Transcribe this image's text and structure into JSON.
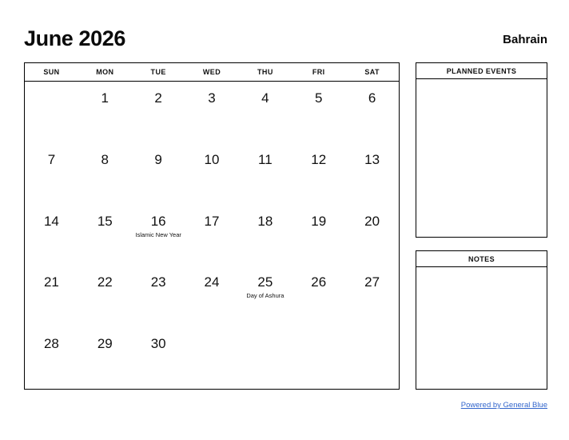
{
  "header": {
    "month_title": "June 2026",
    "country": "Bahrain"
  },
  "calendar": {
    "weekday_headers": [
      "SUN",
      "MON",
      "TUE",
      "WED",
      "THU",
      "FRI",
      "SAT"
    ],
    "weeks": [
      [
        {
          "day": "",
          "event": ""
        },
        {
          "day": "1",
          "event": ""
        },
        {
          "day": "2",
          "event": ""
        },
        {
          "day": "3",
          "event": ""
        },
        {
          "day": "4",
          "event": ""
        },
        {
          "day": "5",
          "event": ""
        },
        {
          "day": "6",
          "event": ""
        }
      ],
      [
        {
          "day": "7",
          "event": ""
        },
        {
          "day": "8",
          "event": ""
        },
        {
          "day": "9",
          "event": ""
        },
        {
          "day": "10",
          "event": ""
        },
        {
          "day": "11",
          "event": ""
        },
        {
          "day": "12",
          "event": ""
        },
        {
          "day": "13",
          "event": ""
        }
      ],
      [
        {
          "day": "14",
          "event": ""
        },
        {
          "day": "15",
          "event": ""
        },
        {
          "day": "16",
          "event": "Islamic New Year"
        },
        {
          "day": "17",
          "event": ""
        },
        {
          "day": "18",
          "event": ""
        },
        {
          "day": "19",
          "event": ""
        },
        {
          "day": "20",
          "event": ""
        }
      ],
      [
        {
          "day": "21",
          "event": ""
        },
        {
          "day": "22",
          "event": ""
        },
        {
          "day": "23",
          "event": ""
        },
        {
          "day": "24",
          "event": ""
        },
        {
          "day": "25",
          "event": "Day of Ashura"
        },
        {
          "day": "26",
          "event": ""
        },
        {
          "day": "27",
          "event": ""
        }
      ],
      [
        {
          "day": "28",
          "event": ""
        },
        {
          "day": "29",
          "event": ""
        },
        {
          "day": "30",
          "event": ""
        },
        {
          "day": "",
          "event": ""
        },
        {
          "day": "",
          "event": ""
        },
        {
          "day": "",
          "event": ""
        },
        {
          "day": "",
          "event": ""
        }
      ]
    ]
  },
  "panels": {
    "planned_events": {
      "title": "PLANNED EVENTS",
      "content": ""
    },
    "notes": {
      "title": "NOTES",
      "content": ""
    }
  },
  "footer": {
    "link_label": "Powered by General Blue"
  },
  "colors": {
    "text": "#111111",
    "border": "#000000",
    "link": "#3366cc",
    "background": "#ffffff"
  }
}
